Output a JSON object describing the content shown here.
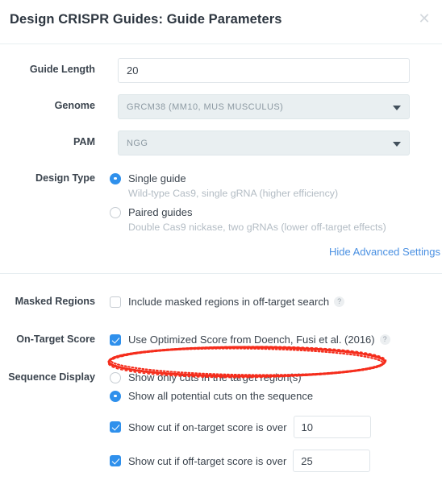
{
  "dialog": {
    "title": "Design CRISPR Guides: Guide Parameters",
    "close_label": "✕"
  },
  "fields": {
    "guide_length": {
      "label": "Guide Length",
      "value": "20"
    },
    "genome": {
      "label": "Genome",
      "value": "GRCM38 (MM10, MUS MUSCULUS)"
    },
    "pam": {
      "label": "PAM",
      "value": "NGG"
    },
    "design_type": {
      "label": "Design Type",
      "options": [
        {
          "label": "Single guide",
          "sublabel": "Wild-type Cas9, single gRNA (higher efficiency)",
          "selected": true
        },
        {
          "label": "Paired guides",
          "sublabel": "Double Cas9 nickase, two gRNAs (lower off-target effects)",
          "selected": false
        }
      ]
    },
    "advanced_link": "Hide Advanced Settings",
    "masked_regions": {
      "label": "Masked Regions",
      "checkbox_label": "Include masked regions in off-target search",
      "checked": false,
      "help": "?"
    },
    "on_target_score": {
      "label": "On-Target Score",
      "checkbox_label": "Use Optimized Score from Doench, Fusi et al. (2016)",
      "checked": true,
      "help": "?"
    },
    "sequence_display": {
      "label": "Sequence Display",
      "options": [
        {
          "label": "Show only cuts in the target region(s)",
          "selected": false
        },
        {
          "label": "Show all potential cuts on the sequence",
          "selected": true
        }
      ],
      "thresholds": [
        {
          "label": "Show cut if on-target score is over",
          "checked": true,
          "value": "10"
        },
        {
          "label": "Show cut if off-target score is over",
          "checked": true,
          "value": "25"
        }
      ]
    }
  },
  "annotation": {
    "color": "#f52d1c",
    "shape": "ellipse",
    "target": "on-target-score-checkbox-row"
  }
}
